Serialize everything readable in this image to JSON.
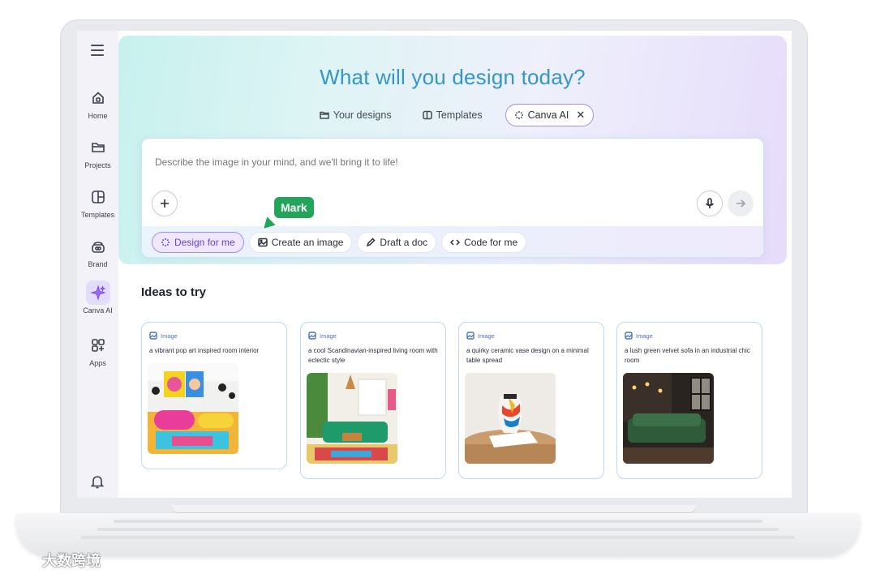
{
  "sidebar": {
    "items": [
      {
        "label": "Home",
        "icon": "home-icon"
      },
      {
        "label": "Projects",
        "icon": "folder-icon"
      },
      {
        "label": "Templates",
        "icon": "templates-icon"
      },
      {
        "label": "Brand",
        "icon": "brand-icon"
      },
      {
        "label": "Canva AI",
        "icon": "sparkle-icon",
        "active": true
      },
      {
        "label": "Apps",
        "icon": "apps-icon"
      }
    ]
  },
  "hero": {
    "title": "What will you design today?",
    "tabs": [
      {
        "label": "Your designs",
        "icon": "folder-icon"
      },
      {
        "label": "Templates",
        "icon": "templates-icon"
      },
      {
        "label": "Canva AI",
        "icon": "sparkle-icon",
        "active": true
      }
    ]
  },
  "prompt": {
    "placeholder": "Describe the image in your mind, and we'll bring it to life!",
    "chips": [
      {
        "label": "Design for me",
        "icon": "sparkle-icon",
        "active": true
      },
      {
        "label": "Create an image",
        "icon": "image-icon"
      },
      {
        "label": "Draft a doc",
        "icon": "pen-icon"
      },
      {
        "label": "Code for me",
        "icon": "code-icon"
      }
    ]
  },
  "annotation": {
    "label": "Mark"
  },
  "ideas": {
    "title": "Ideas to try",
    "cards": [
      {
        "type": "Image",
        "desc": "a vibrant pop art inspired room interior"
      },
      {
        "type": "Image",
        "desc": "a cool Scandinavian-inspired living room with eclectic style"
      },
      {
        "type": "Image",
        "desc": "a quirky ceramic vase design on a minimal table spread"
      },
      {
        "type": "Image",
        "desc": "a lush green velvet sofa in an industrial chic room"
      }
    ]
  },
  "watermark": {
    "text": "大数跨境"
  },
  "colors": {
    "accent": "#7b4bf2",
    "title": "#3596c7",
    "mark": "#22a55a"
  }
}
